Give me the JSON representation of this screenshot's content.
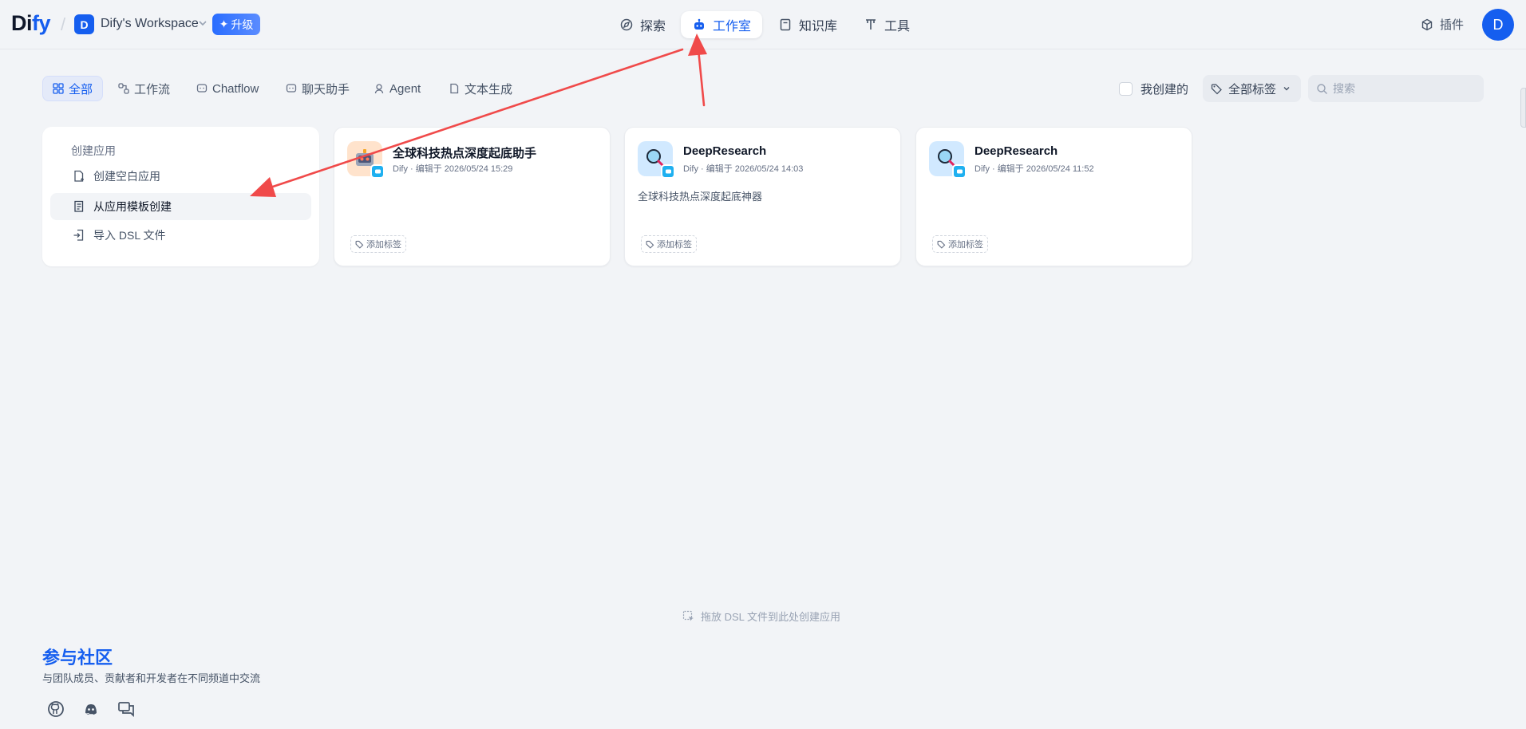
{
  "header": {
    "logo_main": "Di",
    "logo_accent": "fy",
    "workspace_initial": "D",
    "workspace_name": "Dify's Workspace",
    "upgrade_label": "升级",
    "nav": [
      {
        "label": "探索",
        "icon": "compass-icon"
      },
      {
        "label": "工作室",
        "icon": "robot-icon"
      },
      {
        "label": "知识库",
        "icon": "book-icon"
      },
      {
        "label": "工具",
        "icon": "hammer-icon"
      }
    ],
    "active_nav": "工作室",
    "plugin_label": "插件",
    "user_initial": "D"
  },
  "filters": {
    "tabs": [
      "全部",
      "工作流",
      "Chatflow",
      "聊天助手",
      "Agent",
      "文本生成"
    ],
    "active": "全部",
    "mine_label": "我创建的",
    "tag_label": "全部标签",
    "search_placeholder": "搜索"
  },
  "create": {
    "title": "创建应用",
    "items": [
      "创建空白应用",
      "从应用模板创建",
      "导入 DSL 文件"
    ]
  },
  "apps": [
    {
      "name": "全球科技热点深度起底助手",
      "meta": "Dify · 编辑于 2026/05/24 15:29",
      "description": "",
      "tag_label": "添加标签",
      "icon": "robot-face-icon"
    },
    {
      "name": "DeepResearch",
      "meta": "Dify · 编辑于 2026/05/24 14:03",
      "description": "全球科技热点深度起底神器",
      "tag_label": "添加标签",
      "icon": "magnifier-icon"
    },
    {
      "name": "DeepResearch",
      "meta": "Dify · 编辑于 2026/05/24 11:52",
      "description": "",
      "tag_label": "添加标签",
      "icon": "magnifier-icon"
    }
  ],
  "drop_hint": "拖放 DSL 文件到此处创建应用",
  "community": {
    "title": "参与社区",
    "subtitle": "与团队成员、贡献者和开发者在不同频道中交流",
    "links": [
      "github-icon",
      "discord-icon",
      "forum-icon"
    ]
  },
  "colors": {
    "accent": "#155eef",
    "annotation_arrow": "#f04a4a",
    "background": "#f2f4f7"
  }
}
